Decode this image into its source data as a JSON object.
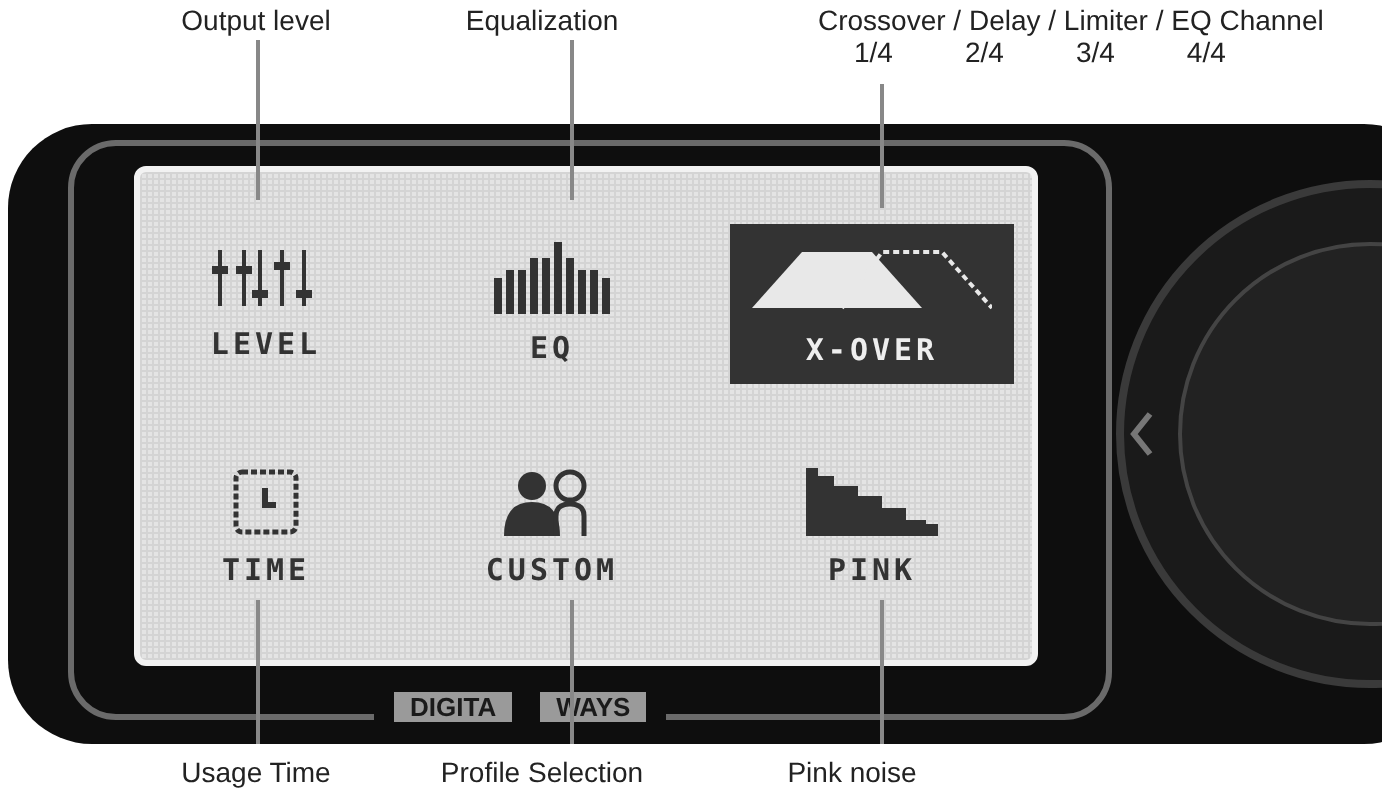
{
  "annotations_top": [
    {
      "text": "Output level"
    },
    {
      "text": "Equalization"
    },
    {
      "text": "Crossover / Delay / Limiter / EQ Channel",
      "fractions": [
        "1/4",
        "2/4",
        "3/4",
        "4/4"
      ]
    }
  ],
  "menu": [
    {
      "label": "LEVEL",
      "kind": "level",
      "selected": false
    },
    {
      "label": "EQ",
      "kind": "eq",
      "selected": false
    },
    {
      "label": "X-OVER",
      "kind": "xover",
      "selected": true
    },
    {
      "label": "TIME",
      "kind": "time",
      "selected": false
    },
    {
      "label": "CUSTOM",
      "kind": "custom",
      "selected": false
    },
    {
      "label": "PINK",
      "kind": "pink",
      "selected": false
    }
  ],
  "brand": [
    "DIGITA",
    "WAYS"
  ],
  "annotations_bottom": [
    "Usage Time",
    "Profile Selection",
    "Pink noise"
  ]
}
